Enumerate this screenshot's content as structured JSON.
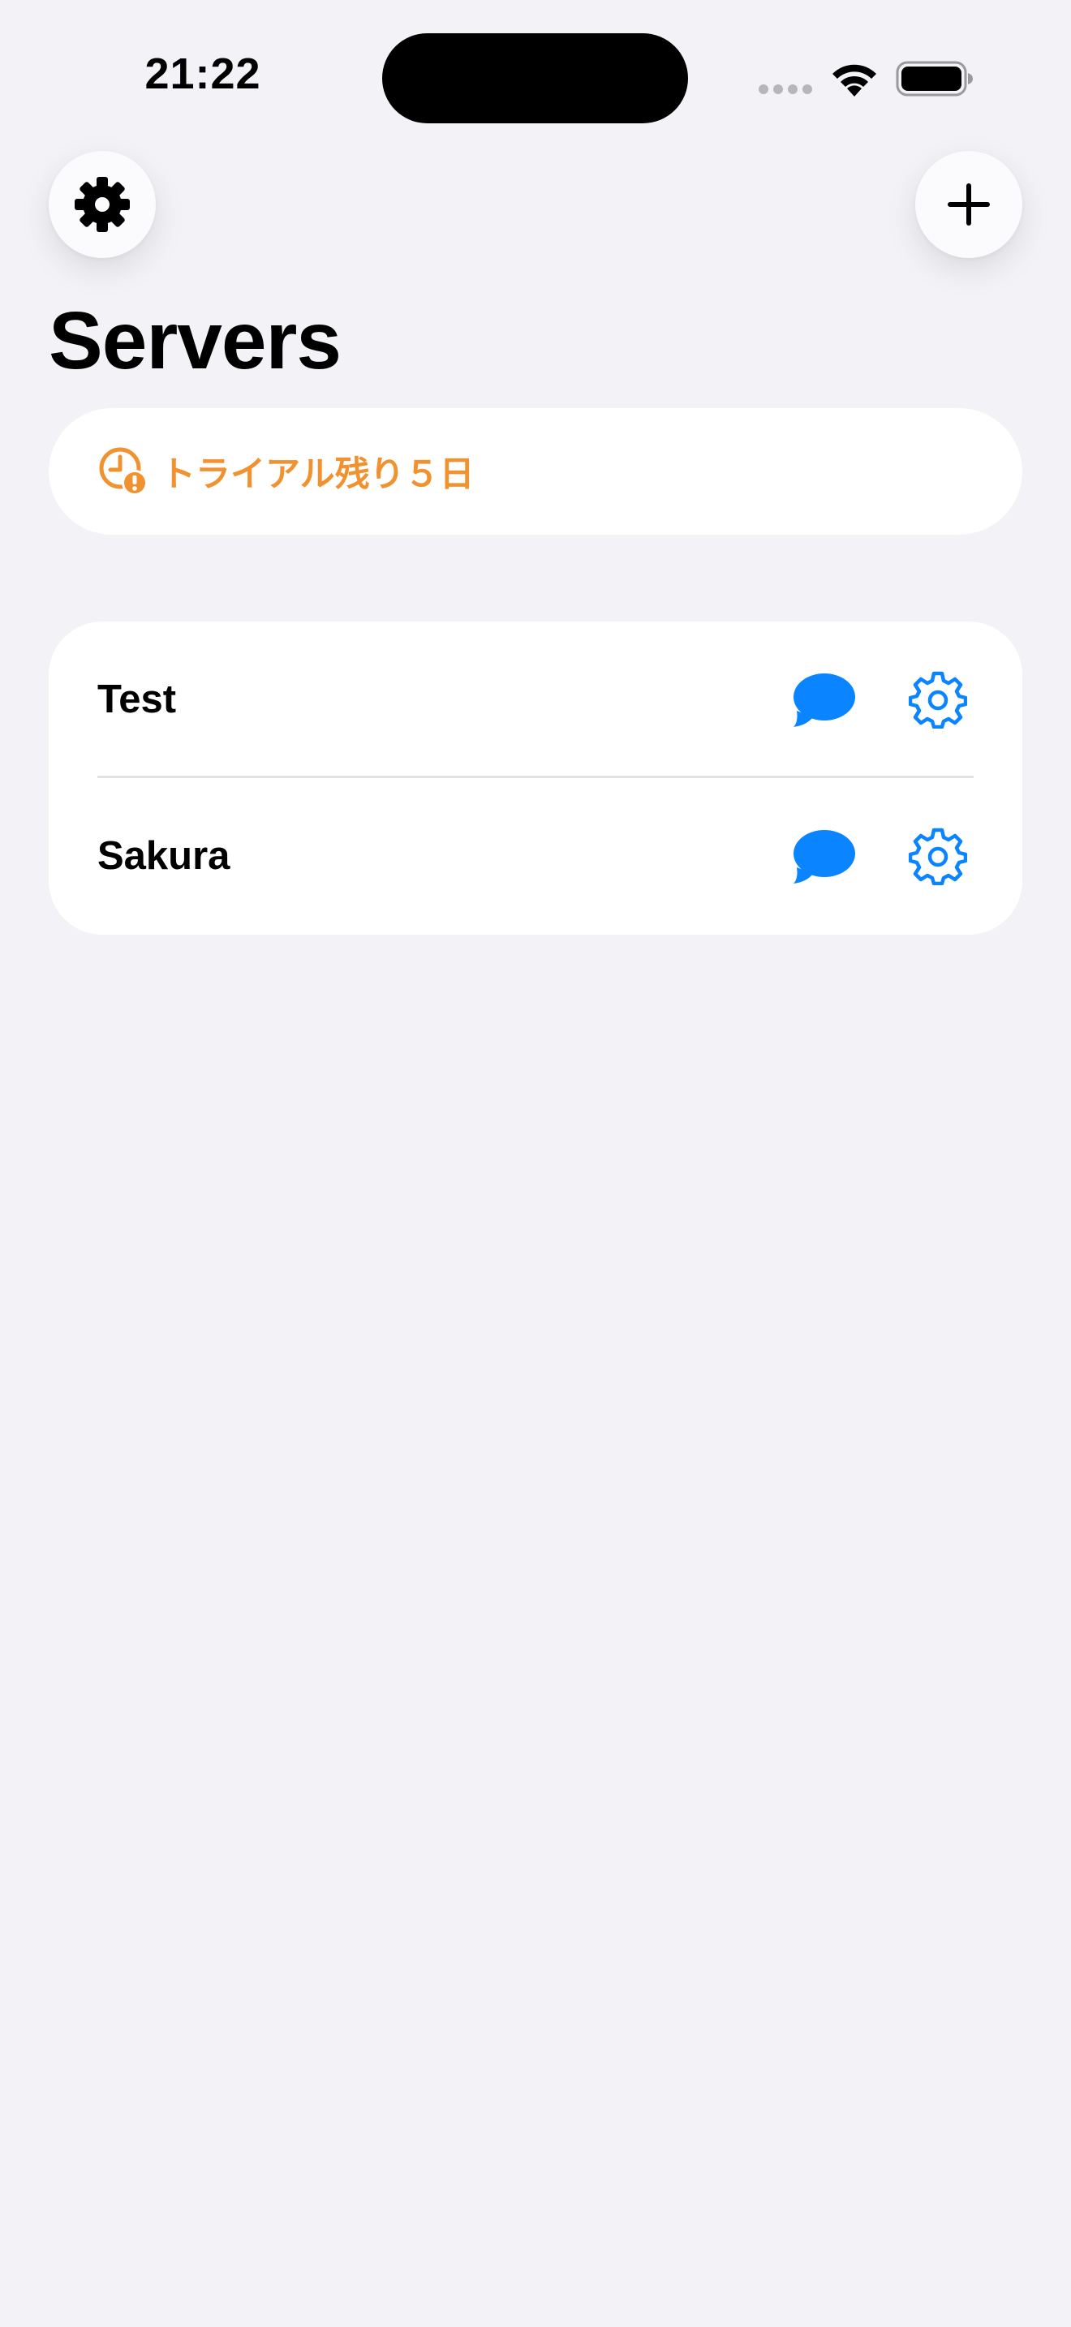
{
  "status_bar": {
    "time": "21:22"
  },
  "icons": {
    "settings": "gear-icon",
    "add": "plus-icon",
    "trial": "clock-alert-icon",
    "chat": "chat-bubble-icon",
    "server_settings": "gear-outline-icon",
    "wifi": "wifi-icon",
    "battery": "battery-icon"
  },
  "colors": {
    "background": "#f2f2f7",
    "accent": "#0a84ff",
    "trial": "#f0922f"
  },
  "header": {
    "title": "Servers"
  },
  "trial_banner": {
    "text": "トライアル残り５日"
  },
  "servers": [
    {
      "name": "Test"
    },
    {
      "name": "Sakura"
    }
  ]
}
